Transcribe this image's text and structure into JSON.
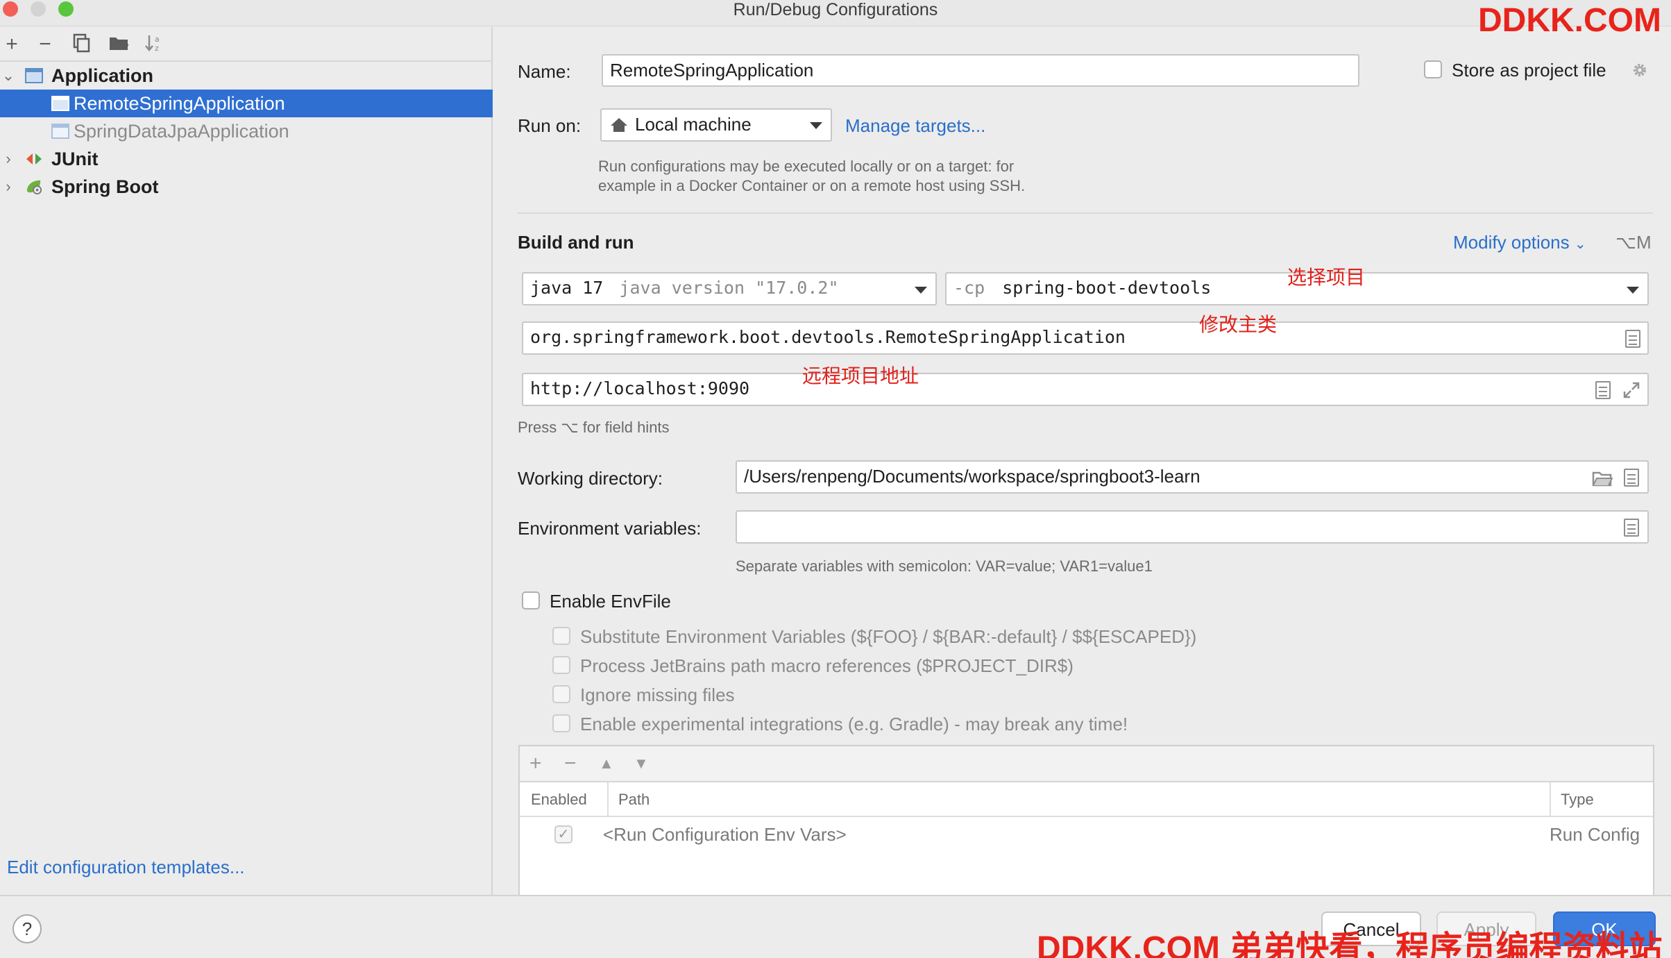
{
  "window": {
    "title": "Run/Debug Configurations"
  },
  "left": {
    "toolbar": [
      "add-icon",
      "remove-icon",
      "copy-icon",
      "folder-icon",
      "sort-icon"
    ],
    "tree": [
      {
        "label": "Application",
        "bold": true
      },
      {
        "label": "RemoteSpringApplication",
        "selected": true
      },
      {
        "label": "SpringDataJpaApplication"
      },
      {
        "label": "JUnit",
        "bold": true
      },
      {
        "label": "Spring Boot",
        "bold": true
      }
    ],
    "edit_templates": "Edit configuration templates..."
  },
  "form": {
    "name_label": "Name:",
    "name_value": "RemoteSpringApplication",
    "store_label": "Store as project file",
    "run_on_label": "Run on:",
    "run_on_value": "Local machine",
    "manage_targets": "Manage targets...",
    "run_on_hint_1": "Run configurations may be executed locally or on a target: for",
    "run_on_hint_2": "example in a Docker Container or on a remote host using SSH.",
    "build_run_title": "Build and run",
    "modify_options": "Modify options",
    "modify_shortcut": "⌥M",
    "jdk_main": "java 17",
    "jdk_version": "java version \"17.0.2\"",
    "cp_prefix": "-cp",
    "cp_value": "spring-boot-devtools",
    "main_class": "org.springframework.boot.devtools.RemoteSpringApplication",
    "program_args": "http://localhost:9090",
    "field_hints": "Press ⌥ for field hints",
    "workdir_label": "Working directory:",
    "workdir_value": "/Users/renpeng/Documents/workspace/springboot3-learn",
    "env_label": "Environment variables:",
    "env_value": "",
    "env_hint": "Separate variables with semicolon: VAR=value; VAR1=value1",
    "envfile_label": "Enable EnvFile",
    "envfile_options": [
      "Substitute Environment Variables (${FOO} / ${BAR:-default} / $${ESCAPED})",
      "Process JetBrains path macro references ($PROJECT_DIR$)",
      "Ignore missing files",
      "Enable experimental integrations (e.g. Gradle) - may break any time!"
    ]
  },
  "env_table": {
    "toolbar": [
      "+",
      "−",
      "▲",
      "▼"
    ],
    "headers": {
      "enabled": "Enabled",
      "path": "Path",
      "type": "Type"
    },
    "rows": [
      {
        "enabled": true,
        "path": "<Run Configuration Env Vars>",
        "type": "Run Config"
      }
    ]
  },
  "annotations": {
    "select_project": "选择项目",
    "modify_main": "修改主类",
    "remote_addr": "远程项目地址"
  },
  "watermark": {
    "top": "DDKK.COM",
    "bottom": "DDKK.COM 弟弟快看，程序员编程资料站"
  },
  "buttons": {
    "help": "?",
    "cancel": "Cancel",
    "apply": "Apply",
    "ok": "OK"
  },
  "colors": {
    "accent": "#2f6fd1",
    "link": "#2a6fc9",
    "annotation": "#e0211b"
  }
}
